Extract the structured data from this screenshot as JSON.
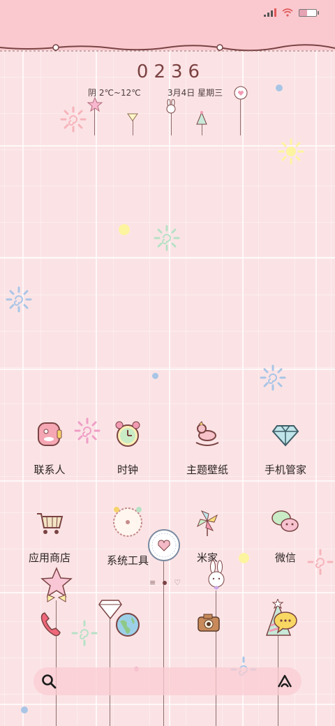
{
  "status_bar": {
    "signal": "signal-icon",
    "wifi": "wifi-icon",
    "battery": "battery-icon"
  },
  "clock_widget": {
    "time": "0236",
    "weather": "阴 2℃~12℃",
    "date": "3月4日 星期三"
  },
  "apps": [
    {
      "label": "联系人",
      "icon": "contacts-icon"
    },
    {
      "label": "时钟",
      "icon": "alarm-clock-icon"
    },
    {
      "label": "主题壁纸",
      "icon": "rocking-horse-icon"
    },
    {
      "label": "手机管家",
      "icon": "diamond-icon"
    },
    {
      "label": "应用商店",
      "icon": "shopping-cart-icon"
    },
    {
      "label": "系统工具",
      "icon": "tools-clock-icon"
    },
    {
      "label": "米家",
      "icon": "pinwheel-icon"
    },
    {
      "label": "微信",
      "icon": "chat-bubbles-icon"
    }
  ],
  "dock": [
    {
      "icon": "phone-icon"
    },
    {
      "icon": "browser-globe-icon"
    },
    {
      "icon": "camera-icon"
    },
    {
      "icon": "message-icon"
    }
  ],
  "colors": {
    "background": "#fbe3e5",
    "header": "#f9c9cf",
    "accent": "#e88aa8"
  }
}
